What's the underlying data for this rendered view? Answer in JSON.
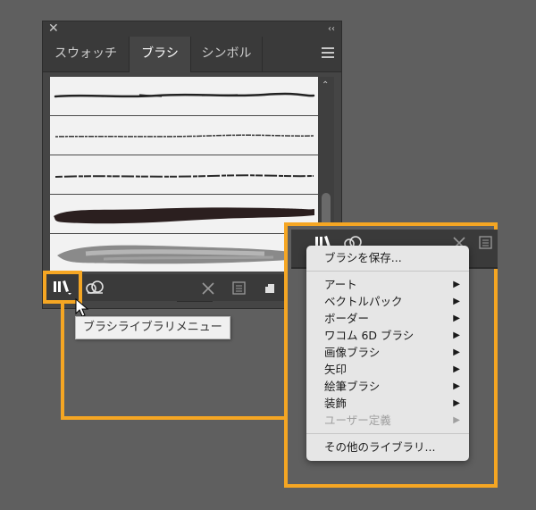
{
  "panel": {
    "tabs": [
      {
        "label": "スウォッチ"
      },
      {
        "label": "ブラシ"
      },
      {
        "label": "シンボル"
      }
    ]
  },
  "tooltip": {
    "text": "ブラシライブラリメニュー"
  },
  "menu": {
    "save": "ブラシを保存...",
    "items": [
      {
        "label": "アート",
        "has_submenu": true,
        "enabled": true
      },
      {
        "label": "ベクトルパック",
        "has_submenu": true,
        "enabled": true
      },
      {
        "label": "ボーダー",
        "has_submenu": true,
        "enabled": true
      },
      {
        "label": "ワコム 6D ブラシ",
        "has_submenu": true,
        "enabled": true
      },
      {
        "label": "画像ブラシ",
        "has_submenu": true,
        "enabled": true
      },
      {
        "label": "矢印",
        "has_submenu": true,
        "enabled": true
      },
      {
        "label": "絵筆ブラシ",
        "has_submenu": true,
        "enabled": true
      },
      {
        "label": "装飾",
        "has_submenu": true,
        "enabled": true
      },
      {
        "label": "ユーザー定義",
        "has_submenu": true,
        "enabled": false
      }
    ],
    "other": "その他のライブラリ..."
  },
  "icons": {
    "close": "close-icon",
    "collapse": "collapse-icon",
    "panel_menu": "hamburger-menu-icon",
    "brush_library": "brush-library-icon",
    "creative_cloud_libraries": "creative-cloud-libraries-icon",
    "remove_stroke": "remove-brush-stroke-icon",
    "brush_options": "brush-options-icon",
    "new_brush": "new-brush-icon",
    "delete": "trash-icon"
  },
  "colors": {
    "highlight": "#f5a623",
    "panel": "#454545",
    "menu": "#e6e6e6"
  }
}
